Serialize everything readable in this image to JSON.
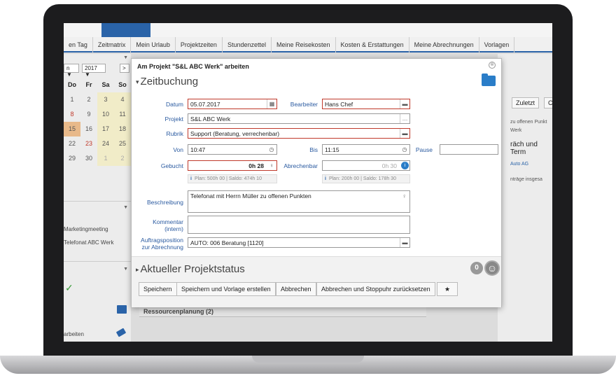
{
  "nav": [
    "en Tag",
    "Zeitmatrix",
    "Mein Urlaub",
    "Projektzeiten",
    "Stundenzettel",
    "Meine Reisekosten",
    "Kosten & Erstattungen",
    "Meine Abrechnungen",
    "Vorlagen"
  ],
  "calendar": {
    "month_select": "n ▼",
    "year_select": "2017 ▼",
    "next": ">",
    "days": [
      "Do",
      "Fr",
      "Sa",
      "So"
    ],
    "rows": [
      [
        "1",
        "2",
        "3",
        "4"
      ],
      [
        "8",
        "9",
        "10",
        "11"
      ],
      [
        "15",
        "16",
        "17",
        "18"
      ],
      [
        "22",
        "23",
        "24",
        "25"
      ],
      [
        "29",
        "30",
        "1",
        "2"
      ]
    ]
  },
  "left_list": [
    "Marketingmeeting",
    "Telefonat ABC Werk"
  ],
  "left_bottom_label": "arbeiten",
  "right_panel": {
    "btn1": "Zuletzt",
    "btn2": "C",
    "lines": [
      "zu offenen Punkt",
      "Werk",
      "räch und Term",
      "Auto AG",
      "nträge insgesa"
    ]
  },
  "modal": {
    "title": "Am Projekt \"S&L ABC Werk\" arbeiten",
    "close": "⊗",
    "section1": "Zeitbuchung",
    "section2": "Aktueller Projektstatus",
    "fields": {
      "datum_label": "Datum",
      "datum": "05.07.2017",
      "bearbeiter_label": "Bearbeiter",
      "bearbeiter": "Hans Chef",
      "projekt_label": "Projekt",
      "projekt": "S&L ABC Werk",
      "rubrik_label": "Rubrik",
      "rubrik": "Support (Beratung, verrechenbar)",
      "von_label": "Von",
      "von": "10:47",
      "bis_label": "Bis",
      "bis": "11:15",
      "pause_label": "Pause",
      "pause": "",
      "gebucht_label": "Gebucht",
      "gebucht": "0h 28",
      "abrechenbar_label": "Abrechenbar",
      "abrechenbar": "0h 30",
      "hint_left": "Plan: 500h 00 | Saldo: 474h 10",
      "hint_right": "Plan: 200h 00 | Saldo: 178h 30",
      "beschreibung_label": "Beschreibung",
      "beschreibung": "Telefonat mit Herrn Müller zu offenen Punkten",
      "kommentar_label": "Kommentar (intern)",
      "kommentar": "",
      "auftrag_label": "Auftragsposition zur Abrechnung",
      "auftrag": "AUTO: 006 Beratung [1120]"
    },
    "badge": "0",
    "buttons": [
      "Speichern",
      "Speichern und Vorlage erstellen",
      "Abbrechen",
      "Abbrechen und Stoppuhr zurücksetzen",
      "★"
    ]
  },
  "behind_bar": "Ressourcenplanung (2)"
}
